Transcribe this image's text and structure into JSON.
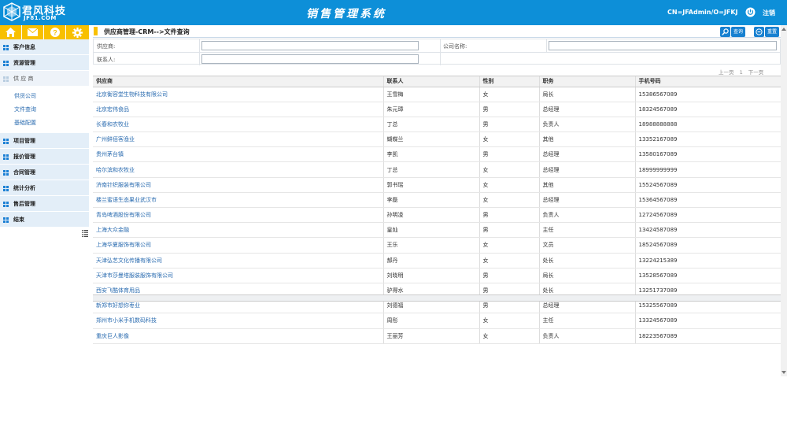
{
  "header": {
    "brand": "君风科技",
    "brand_sub": "JF81.COM",
    "app_title": "销售管理系统",
    "user": "CN=JFAdmin/O=JFKJ",
    "logout": "注销"
  },
  "sidebar": {
    "items": [
      {
        "label": "客户信息"
      },
      {
        "label": "资源管理"
      },
      {
        "label": "供 应 商"
      },
      {
        "label": "项目管理"
      },
      {
        "label": "报价管理"
      },
      {
        "label": "合同管理"
      },
      {
        "label": "统计分析"
      },
      {
        "label": "售后管理"
      },
      {
        "label": "结束"
      }
    ],
    "sub_items": [
      {
        "label": "供货公司"
      },
      {
        "label": "文件查询"
      },
      {
        "label": "基础配置"
      }
    ]
  },
  "main": {
    "breadcrumb": "供应商管理-CRM-->文件查询",
    "search_label": "查询",
    "reset_label": "重置",
    "form": {
      "supplier_label": "供应商:",
      "company_label": "公司名称:",
      "contact_label": "联系人:"
    },
    "pager": {
      "prev": "上一页",
      "page": "1",
      "next": "下一页"
    },
    "table": {
      "headers": [
        "供应商",
        "联系人",
        "性别",
        "职务",
        "手机号码"
      ],
      "rows": [
        [
          "北京衡容堂生物科技有限公司",
          "王雪梅",
          "女",
          "局长",
          "15386567089"
        ],
        [
          "北京宏伟食品",
          "朱元璋",
          "男",
          "总经理",
          "18324567089"
        ],
        [
          "长春和农牧业",
          "丁总",
          "男",
          "负责人",
          "18988888888"
        ],
        [
          "广州鲜佰客渔业",
          "蝴蝶兰",
          "女",
          "其他",
          "13352167089"
        ],
        [
          "贵州茅台镇",
          "李凯",
          "男",
          "总经理",
          "13580167089"
        ],
        [
          "哈尔滨和农牧业",
          "丁总",
          "女",
          "总经理",
          "18999999999"
        ],
        [
          "济南针织服装有限公司",
          "郭书瑶",
          "女",
          "其他",
          "15524567089"
        ],
        [
          "楼兰蜜语生态果业武汉市",
          "李磊",
          "女",
          "总经理",
          "15364567089"
        ],
        [
          "青岛啤酒股份有限公司",
          "孙明凌",
          "男",
          "负责人",
          "12724567089"
        ],
        [
          "上海大众金融",
          "皇灿",
          "男",
          "主任",
          "13424587089"
        ],
        [
          "上海华夏服饰有限公司",
          "王乐",
          "女",
          "文员",
          "18524567089"
        ],
        [
          "天津弘艺文化传播有限公司",
          "郝丹",
          "女",
          "处长",
          "13224215389"
        ],
        [
          "天津市莎曼塔服装服饰有限公司",
          "刘晓明",
          "男",
          "局长",
          "13528567089"
        ],
        [
          "西安飞酷体育用品",
          "驴得水",
          "男",
          "处长",
          "13251737089"
        ],
        [
          "新郑市好想你枣业",
          "刘德福",
          "男",
          "总经理",
          "15325567089"
        ],
        [
          "郑州市小米手机数码科技",
          "周彤",
          "女",
          "主任",
          "13324567089"
        ],
        [
          "重庆巨人影像",
          "王丽芳",
          "女",
          "负责人",
          "18223567089"
        ]
      ]
    }
  },
  "colors": {
    "header_bg": "#0d8fd8",
    "toolbar_bg": "#f8c000",
    "sidebar_bg": "#e3eef8",
    "link": "#2b6cb0",
    "button_bg": "#1780d0"
  }
}
